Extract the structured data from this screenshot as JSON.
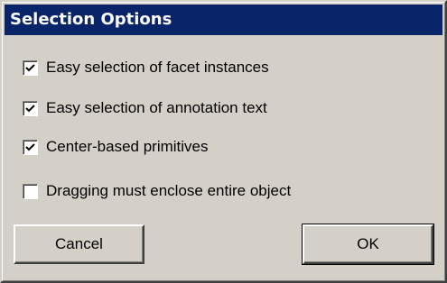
{
  "dialog": {
    "title": "Selection Options"
  },
  "options": [
    {
      "label": "Easy selection of facet instances",
      "checked": true
    },
    {
      "label": "Easy selection of annotation text",
      "checked": true
    },
    {
      "label": "Center-based primitives",
      "checked": true
    },
    {
      "label": "Dragging must enclose entire object",
      "checked": false
    }
  ],
  "buttons": {
    "cancel_label": "Cancel",
    "ok_label": "OK"
  },
  "colors": {
    "title_bar": "#0a246a",
    "dialog_face": "#d4d0c8"
  }
}
